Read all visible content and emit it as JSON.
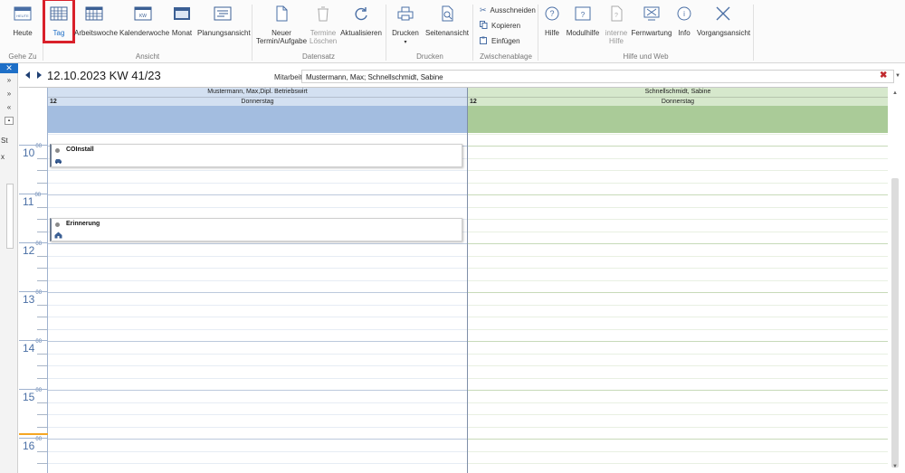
{
  "ribbon": {
    "groups": [
      {
        "label": "Gehe Zu"
      },
      {
        "label": "Ansicht"
      },
      {
        "label": "Datensatz"
      },
      {
        "label": "Drucken"
      },
      {
        "label": "Zwischenablage"
      },
      {
        "label": "Hilfe und Web"
      }
    ],
    "buttons": {
      "heute": "Heute",
      "tag": "Tag",
      "arbeitswoche": "Arbeitswoche",
      "kalenderwoche": "Kalenderwoche",
      "monat": "Monat",
      "planungsansicht": "Planungsansicht",
      "neuer1": "Neuer",
      "neuer2": "Termin/Aufgabe",
      "termine1": "Termine",
      "termine2": "Löschen",
      "aktualisieren": "Aktualisieren",
      "drucken": "Drucken",
      "seitenansicht": "Seitenansicht",
      "ausschneiden": "Ausschneiden",
      "kopieren": "Kopieren",
      "einfuegen": "Einfügen",
      "hilfe": "Hilfe",
      "modulhilfe": "Modulhilfe",
      "interne1": "interne",
      "interne2": "Hilfe",
      "fernwartung": "Fernwartung",
      "info": "Info",
      "vorgangsansicht": "Vorgangsansicht",
      "kw_icon_text": "KW",
      "heute_icon_text": "HEUTE"
    }
  },
  "leftpanel": {
    "st": "St",
    "x": "x"
  },
  "nav": {
    "date_title": "12.10.2023 KW 41/23",
    "mitarbeiter_label": "Mitarbeiter",
    "mitarbeiter_value": "Mustermann, Max; Schnellschmidt, Sabine"
  },
  "calendar": {
    "columns": [
      {
        "name": "Mustermann, Max,Dipl. Betriebswirt",
        "day_num": "12",
        "day_name": "Donnerstag",
        "color": "#a3bde0",
        "header_color": "#d3e0f1"
      },
      {
        "name": "Schnellschmidt, Sabine",
        "day_num": "12",
        "day_name": "Donnerstag",
        "color": "#aacb98",
        "header_color": "#d6e8cc"
      }
    ],
    "hours": [
      "10",
      "11",
      "12",
      "13",
      "14",
      "15",
      "16"
    ],
    "minutes_sup": "00",
    "appointments": [
      {
        "title": "COInstall",
        "icon": "car-icon"
      },
      {
        "title": "Erinnerung",
        "icon": "house-icon"
      }
    ]
  },
  "colors": {
    "accent": "#1e6fc7",
    "highlight": "#d9202a",
    "close_red": "#c0282d"
  }
}
